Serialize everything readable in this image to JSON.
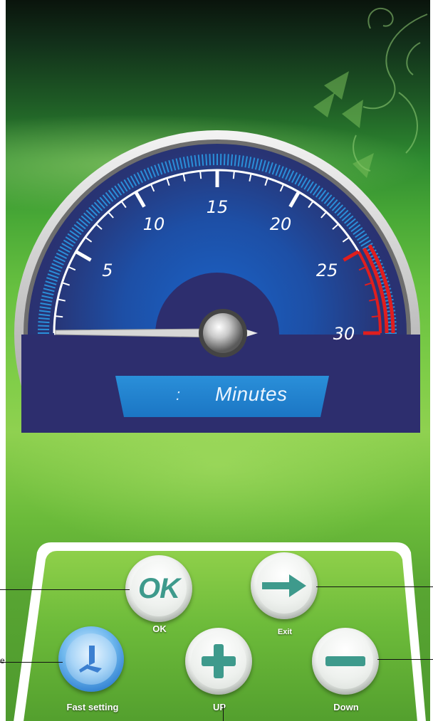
{
  "gauge": {
    "ticks": [
      "5",
      "10",
      "15",
      "20",
      "25",
      "30"
    ],
    "min": 0,
    "max": 30,
    "current_value": 0,
    "unit_label": "Minutes",
    "readout_separator": ":",
    "colors": {
      "face": "#2d2e6e",
      "blue_scale": "#2a8fd9",
      "red_zone": "#e01e1e",
      "readout": "#1f80cc"
    }
  },
  "controls": {
    "ok": {
      "icon_text": "OK",
      "label": "OK",
      "icon": "ok-icon"
    },
    "exit": {
      "label": "Exit",
      "icon": "arrow-right-icon"
    },
    "fast_setting": {
      "label": "Fast setting",
      "icon": "clock-icon"
    },
    "up": {
      "label": "UP",
      "icon": "plus-icon"
    },
    "down": {
      "label": "Down",
      "icon": "minus-icon"
    }
  },
  "callouts": {
    "fast_setting_tail": "e"
  },
  "colors": {
    "panel_green": "#6dbb3a",
    "button_teal": "#3e9a8c",
    "fast_blue": "#2f7fd0"
  }
}
